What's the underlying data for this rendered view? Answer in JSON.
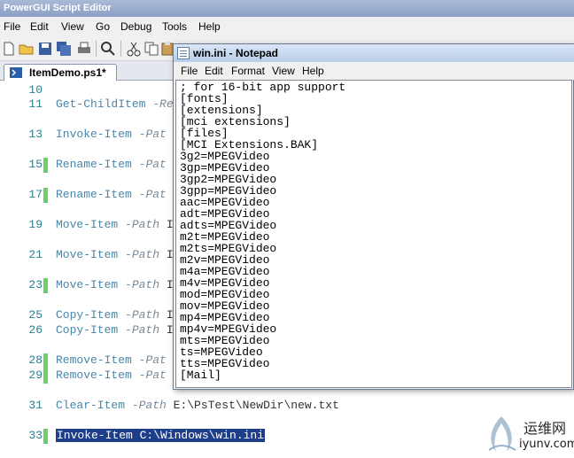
{
  "powergui": {
    "title": "PowerGUI Script Editor",
    "menu": [
      "File",
      "Edit",
      "View",
      "Go",
      "Debug",
      "Tools",
      "Help"
    ],
    "tab": {
      "label": "ItemDemo.ps1*"
    },
    "editor": {
      "lines": [
        {
          "num": "10",
          "text": "",
          "changed": false
        },
        {
          "num": "11",
          "cmd": "Get-ChildItem",
          "param": "-Re",
          "arg": "",
          "changed": false
        },
        {
          "num": "13",
          "cmd": "Invoke-Item",
          "param": "-Pat",
          "arg": "",
          "changed": false
        },
        {
          "num": "15",
          "cmd": "Rename-Item",
          "param": "-Pat",
          "arg": "",
          "changed": true
        },
        {
          "num": "17",
          "cmd": "Rename-Item",
          "param": "-Pat",
          "arg": "",
          "changed": true
        },
        {
          "num": "19",
          "cmd": "Move-Item",
          "param": "-Path",
          "arg": "I",
          "changed": false
        },
        {
          "num": "21",
          "cmd": "Move-Item",
          "param": "-Path",
          "arg": "I",
          "changed": false
        },
        {
          "num": "23",
          "cmd": "Move-Item",
          "param": "-Path",
          "arg": "I",
          "changed": true
        },
        {
          "num": "25",
          "cmd": "Copy-Item",
          "param": "-Path",
          "arg": "I",
          "changed": false
        },
        {
          "num": "26",
          "cmd": "Copy-Item",
          "param": "-Path",
          "arg": "I",
          "changed": false
        },
        {
          "num": "28",
          "cmd": "Remove-Item",
          "param": "-Pat",
          "arg": "",
          "changed": true
        },
        {
          "num": "29",
          "cmd": "Remove-Item",
          "param": "-Pat",
          "arg": "",
          "changed": true
        },
        {
          "num": "31",
          "cmd": "Clear-Item",
          "param": "-Path",
          "arg": "E:\\PsTest\\NewDir\\new.txt",
          "changed": false
        },
        {
          "num": "33",
          "text": "Invoke-Item C:\\Windows\\win.ini",
          "changed": true,
          "selected": true
        }
      ]
    }
  },
  "notepad": {
    "title": "win.ini - Notepad",
    "menu": [
      "File",
      "Edit",
      "Format",
      "View",
      "Help"
    ],
    "content": "; for 16-bit app support\n[fonts]\n[extensions]\n[mci extensions]\n[files]\n[MCI Extensions.BAK]\n3g2=MPEGVideo\n3gp=MPEGVideo\n3gp2=MPEGVideo\n3gpp=MPEGVideo\naac=MPEGVideo\nadt=MPEGVideo\nadts=MPEGVideo\nm2t=MPEGVideo\nm2ts=MPEGVideo\nm2v=MPEGVideo\nm4a=MPEGVideo\nm4v=MPEGVideo\nmod=MPEGVideo\nmov=MPEGVideo\nmp4=MPEGVideo\nmp4v=MPEGVideo\nmts=MPEGVideo\nts=MPEGVideo\ntts=MPEGVideo\n[Mail]"
  },
  "watermark": {
    "cn": "运维网",
    "en": "iyunv.com"
  }
}
